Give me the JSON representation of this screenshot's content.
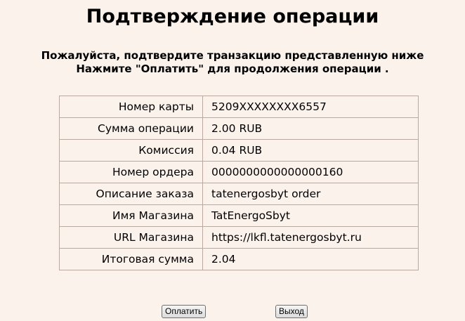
{
  "page": {
    "title": "Подтверждение операции",
    "subtitle_line1": "Пожалуйста, подтвердите транзакцию представленную ниже",
    "subtitle_line2": "Нажмите \"Оплатить\" для продолжения операции ."
  },
  "details": {
    "rows": [
      {
        "label": "Номер карты",
        "value": "5209XXXXXXXX6557"
      },
      {
        "label": "Сумма операции",
        "value": "2.00 RUB"
      },
      {
        "label": "Комиссия",
        "value": "0.04 RUB"
      },
      {
        "label": "Номер ордера",
        "value": "0000000000000000160"
      },
      {
        "label": "Описание заказа",
        "value": "tatenergosbyt order"
      },
      {
        "label": "Имя Магазина",
        "value": "TatEnergoSbyt"
      },
      {
        "label": "URL Магазина",
        "value": "https://lkfl.tatenergosbyt.ru"
      },
      {
        "label": "Итоговая сумма",
        "value": "2.04"
      }
    ]
  },
  "buttons": {
    "pay_label": "Оплатить",
    "exit_label": "Выход"
  },
  "colors": {
    "background": "#fcf2ec",
    "table_border": "#b9a9a1"
  }
}
